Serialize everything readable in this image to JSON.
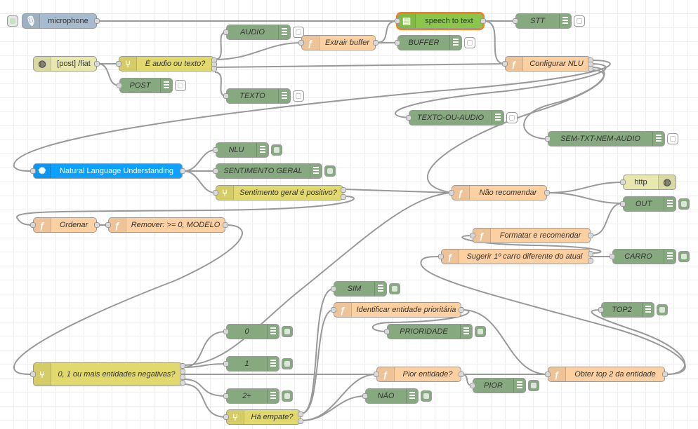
{
  "flow": {
    "nodes": {
      "microphone": "microphone",
      "speech_to_text": "speech to text",
      "stt": "STT",
      "audio": "AUDIO",
      "extrair_buffer": "Extrair buffer",
      "buffer": "BUFFER",
      "post_fiat": "[post] /fiat",
      "e_audio_ou_texto": "É audio ou texto?",
      "configurar_nlu": "Configurar NLU",
      "post": "POST",
      "texto": "TEXTO",
      "texto_ou_audio": "TEXTO-OU-AUDIO",
      "sem_txt_nem_audio": "SEM-TXT-NEM-AUDIO",
      "nlu_debug": "NLU",
      "natural_language_understanding": "Natural Language Understanding",
      "sentimento_geral": "SENTIMENTO GERAL",
      "sentimento_positivo": "Sentimento geral é positivo?",
      "nao_recomendar": "Não recomendar",
      "http": "http",
      "out": "OUT",
      "ordenar": "Ordenar",
      "remover": "Remover: >= 0, MODELO",
      "formatar_recomendar": "Formatar e recomendar",
      "sugerir_carro": "Sugerir 1º carro diferente do atual",
      "carro": "CARRO",
      "sim": "SIM",
      "identificar_entidade": "Identificar entidade prioritária",
      "top2": "TOP2",
      "prioridade": "PRIORIDADE",
      "zero": "0",
      "one": "1",
      "two_plus": "2+",
      "entidades_negativas": "0, 1 ou mais entidades negativas?",
      "pior_entidade": "Pior entidade?",
      "obter_top2": "Obter top 2 da entidade",
      "pior": "PIOR",
      "nao": "NÃO",
      "ha_empate": "Há empate?"
    }
  },
  "colors": {
    "function": "#fdd0a2",
    "switch": "#e2d96e",
    "debug": "#87a980",
    "http_in": "#e7e7ae",
    "microphone": "#a6bbcf",
    "speech_to_text": "#8ac64a",
    "nlu": "#0ca0ff",
    "wire": "#999999"
  },
  "icons": {
    "function": "function-icon",
    "switch": "switch-icon",
    "debug": "debug-icon",
    "http": "globe-icon",
    "microphone": "microphone-icon",
    "speech_to_text": "document-icon",
    "nlu": "watson-icon"
  }
}
